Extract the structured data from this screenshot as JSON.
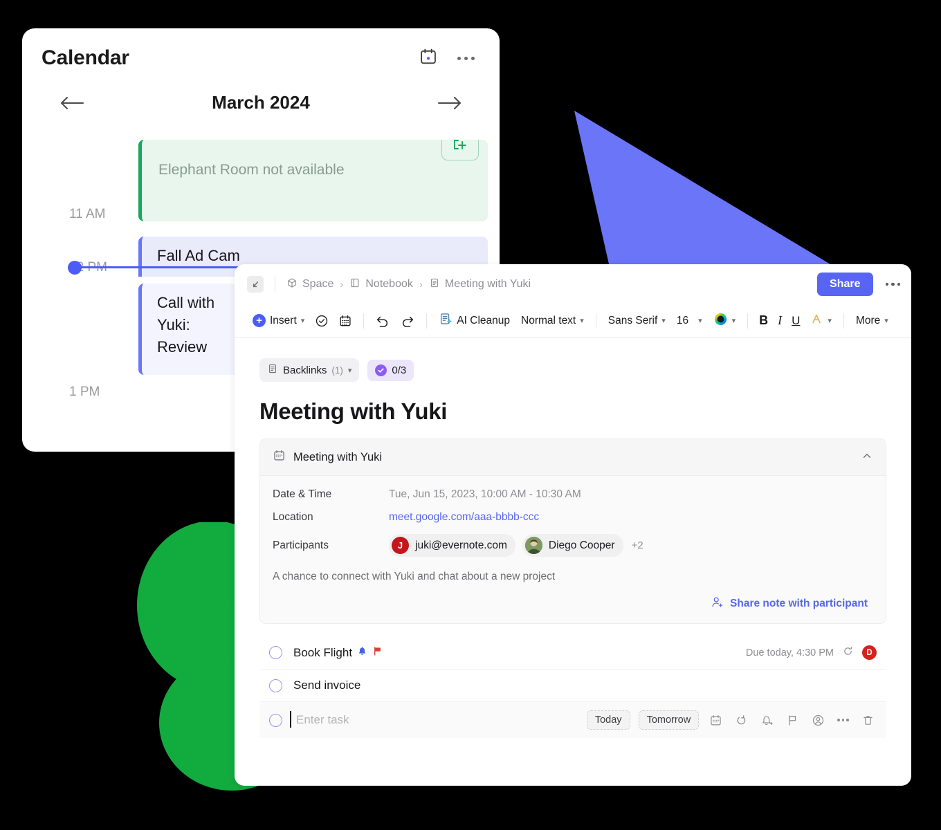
{
  "calendar": {
    "title": "Calendar",
    "icons": {
      "calendar": "calendar-icon",
      "more": "more-horizontal-icon"
    },
    "month": "March 2024",
    "prev_label": "arrow-left-icon",
    "next_label": "arrow-right-icon",
    "hours": [
      "11 AM",
      "12 PM",
      "1 PM"
    ],
    "events": [
      {
        "title": "Elephant Room not available",
        "color": "#1aa65b",
        "bg": "#e8f6ee",
        "action_icon": "add-note-icon"
      },
      {
        "title": "Fall Ad Cam",
        "color": "#6b75f8",
        "bg": "#e9ebfb"
      },
      {
        "title": "Call with Yuki: Review",
        "color": "#6b75f8",
        "bg": "#f3f4fd"
      }
    ],
    "now_indicator_color": "#4c5df5"
  },
  "note": {
    "topbar": {
      "expand_icon": "expand-collapse-icon",
      "breadcrumbs": [
        {
          "label": "Space",
          "icon": "cube-icon"
        },
        {
          "label": "Notebook",
          "icon": "notebook-icon"
        },
        {
          "label": "Meeting with Yuki",
          "icon": "note-icon"
        }
      ],
      "separator": "›",
      "share_label": "Share",
      "share_color": "#5865f2",
      "more_label": "more-horizontal-icon"
    },
    "toolbar": {
      "insert_label": "Insert",
      "task_icon": "check-circle-icon",
      "calendar_icon": "calendar-icon",
      "undo_icon": "undo-icon",
      "redo_icon": "redo-icon",
      "ai_cleanup_label": "AI Cleanup",
      "paragraph_style": "Normal text",
      "font_family": "Sans Serif",
      "font_size": "16",
      "color_label": "color-wheel-icon",
      "bold_label": "B",
      "italic_label": "I",
      "underline_label": "U",
      "highlight_label": "A",
      "more_label": "More"
    },
    "chips": {
      "backlinks_label": "Backlinks",
      "backlinks_count": "(1)",
      "tasks_progress": "0/3"
    },
    "title": "Meeting with Yuki",
    "meeting_card": {
      "header": "Meeting with Yuki",
      "header_icon": "calendar-icon",
      "collapse_icon": "chevron-up-icon",
      "rows": [
        {
          "key": "Date & Time",
          "value": "Tue, Jun 15, 2023, 10:00 AM - 10:30 AM"
        },
        {
          "key": "Location",
          "value": "meet.google.com/aaa-bbbb-ccc",
          "is_link": true
        },
        {
          "key": "Participants"
        }
      ],
      "participants": [
        {
          "name": "juki@evernote.com",
          "initial": "J",
          "avatar_color": "#c4161c"
        },
        {
          "name": "Diego Cooper",
          "initial": "D",
          "avatar_color": "#4e6b3a"
        }
      ],
      "participants_overflow": "+2",
      "description": "A chance to connect with Yuki and chat about a new project",
      "share_action": "Share note with participant",
      "share_action_icon": "person-add-icon"
    },
    "tasks": [
      {
        "label": "Book Flight",
        "badges": [
          "bell-icon",
          "flag-icon"
        ],
        "due": "Due today, 4:30 PM",
        "repeat_icon": "repeat-icon",
        "assignee_initial": "D",
        "assignee_color": "#d4231f"
      },
      {
        "label": "Send invoice"
      }
    ],
    "new_task": {
      "placeholder": "Enter task",
      "quick_today": "Today",
      "quick_tomorrow": "Tomorrow",
      "icons": [
        "calendar-icon",
        "repeat-icon",
        "reminder-bell-icon",
        "flag-icon",
        "assignee-icon",
        "more-horizontal-icon",
        "trash-icon"
      ]
    }
  },
  "decor": {
    "triangle_color": "#6b75f8",
    "clover_color": "#12ab3e",
    "background_color": "#000000"
  }
}
